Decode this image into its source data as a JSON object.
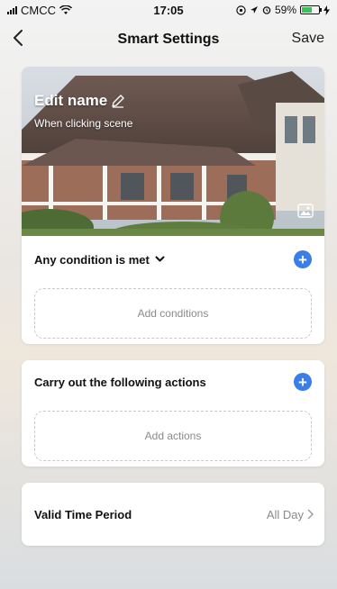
{
  "status_bar": {
    "carrier": "CMCC",
    "time": "17:05",
    "battery_percent": "59%",
    "battery_level": 0.59,
    "icons": [
      "signal-icon",
      "wifi-icon",
      "location-icon",
      "alarm-icon",
      "battery-icon",
      "charging-icon"
    ]
  },
  "nav": {
    "title": "Smart Settings",
    "save_label": "Save",
    "back_icon": "chevron-left-icon"
  },
  "scene": {
    "name_label": "Edit name",
    "subtitle": "When clicking  scene",
    "edit_icon": "pencil-icon",
    "photo_icon": "image-icon"
  },
  "conditions": {
    "title": "Any condition is met",
    "dropdown_icon": "chevron-down-icon",
    "add_label": "Add conditions",
    "accent": "#3b7ee8"
  },
  "actions": {
    "title": "Carry out the following actions",
    "add_label": "Add actions"
  },
  "valid_time": {
    "label": "Valid Time Period",
    "value": "All Day"
  }
}
